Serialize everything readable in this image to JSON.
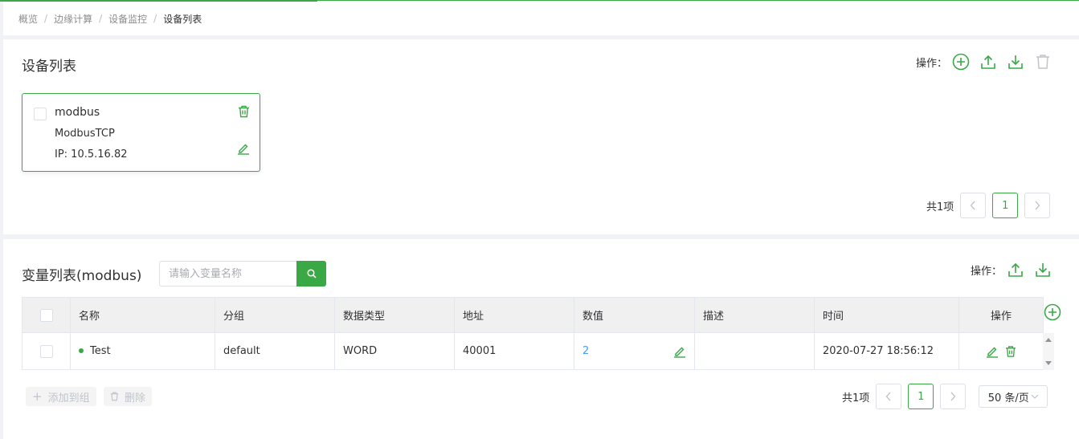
{
  "breadcrumb": [
    "概览",
    "边缘计算",
    "设备监控",
    "设备列表"
  ],
  "breadcrumb_sep": "/",
  "device_panel": {
    "title": "设备列表",
    "ops_label": "操作：",
    "card": {
      "name": "modbus",
      "protocol": "ModbusTCP",
      "ip": "IP: 10.5.16.82"
    },
    "pager": {
      "total": "共1项",
      "page": "1"
    }
  },
  "variable_panel": {
    "title": "变量列表(modbus)",
    "search_placeholder": "请输入变量名称",
    "ops_label": "操作：",
    "columns": [
      "名称",
      "分组",
      "数据类型",
      "地址",
      "数值",
      "描述",
      "时间",
      "操作"
    ],
    "rows": [
      {
        "name": "Test",
        "group": "default",
        "type": "WORD",
        "address": "40001",
        "value": "2",
        "desc": "",
        "time": "2020-07-27 18:56:12"
      }
    ],
    "add_to_group": "添加到组",
    "delete": "删除",
    "pager": {
      "total": "共1项",
      "page": "1",
      "page_size": "50 条/页"
    }
  },
  "colors": {
    "accent": "#39a845",
    "link": "#409eff"
  }
}
